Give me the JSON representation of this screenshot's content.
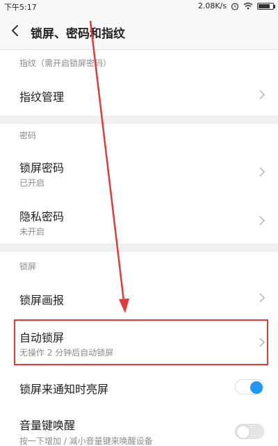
{
  "status_bar": {
    "time": "下午5:17",
    "speed": "2.08K/s",
    "battery_level": 0.8
  },
  "header": {
    "title": "锁屏、密码和指纹",
    "back_icon": "chevron-left-icon"
  },
  "sections": {
    "fingerprint": {
      "label": "指纹（需开启锁屏密码）",
      "items": [
        {
          "title": "指纹管理"
        }
      ]
    },
    "password": {
      "label": "密码",
      "items": [
        {
          "title": "锁屏密码",
          "subtitle": "已开启"
        },
        {
          "title": "隐私密码",
          "subtitle": "未开启"
        }
      ]
    },
    "lockscreen": {
      "label": "锁屏",
      "items": [
        {
          "title": "锁屏画报"
        },
        {
          "title": "自动锁屏",
          "subtitle": "无操作 2 分钟后自动锁屏"
        },
        {
          "title": "锁屏来通知时亮屏",
          "toggle": true
        },
        {
          "title": "音量键唤醒",
          "subtitle": "按一下增加 / 减小音量键来唤醒设备",
          "toggle": false
        }
      ]
    }
  },
  "colors": {
    "accent": "#2196f3",
    "annotation": "#e23a3a",
    "toggle_off": "#e6e6e6"
  }
}
